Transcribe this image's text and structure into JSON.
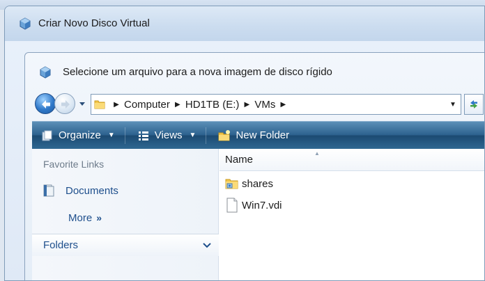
{
  "outer_window": {
    "title": "Criar Novo Disco Virtual"
  },
  "dialog": {
    "title": "Selecione um arquivo para a nova imagem de disco rígido"
  },
  "navigation": {
    "breadcrumb": [
      "Computer",
      "HD1TB (E:)",
      "VMs"
    ]
  },
  "toolbar": {
    "organize_label": "Organize",
    "views_label": "Views",
    "new_folder_label": "New Folder"
  },
  "sidebar": {
    "favorites_header": "Favorite Links",
    "items": [
      {
        "label": "Documents",
        "icon": "documents-icon"
      }
    ],
    "more_label": "More",
    "more_chevron": "»",
    "folders_label": "Folders"
  },
  "file_list": {
    "column_header": "Name",
    "files": [
      {
        "name": "shares",
        "icon": "shared-folder-icon"
      },
      {
        "name": "Win7.vdi",
        "icon": "blank-file-icon"
      }
    ]
  },
  "colors": {
    "toolbar_top": "#5c8fb7",
    "toolbar_bottom": "#1c4a72",
    "link_blue": "#1e4f8c",
    "header_gray": "#6d7b8a"
  }
}
